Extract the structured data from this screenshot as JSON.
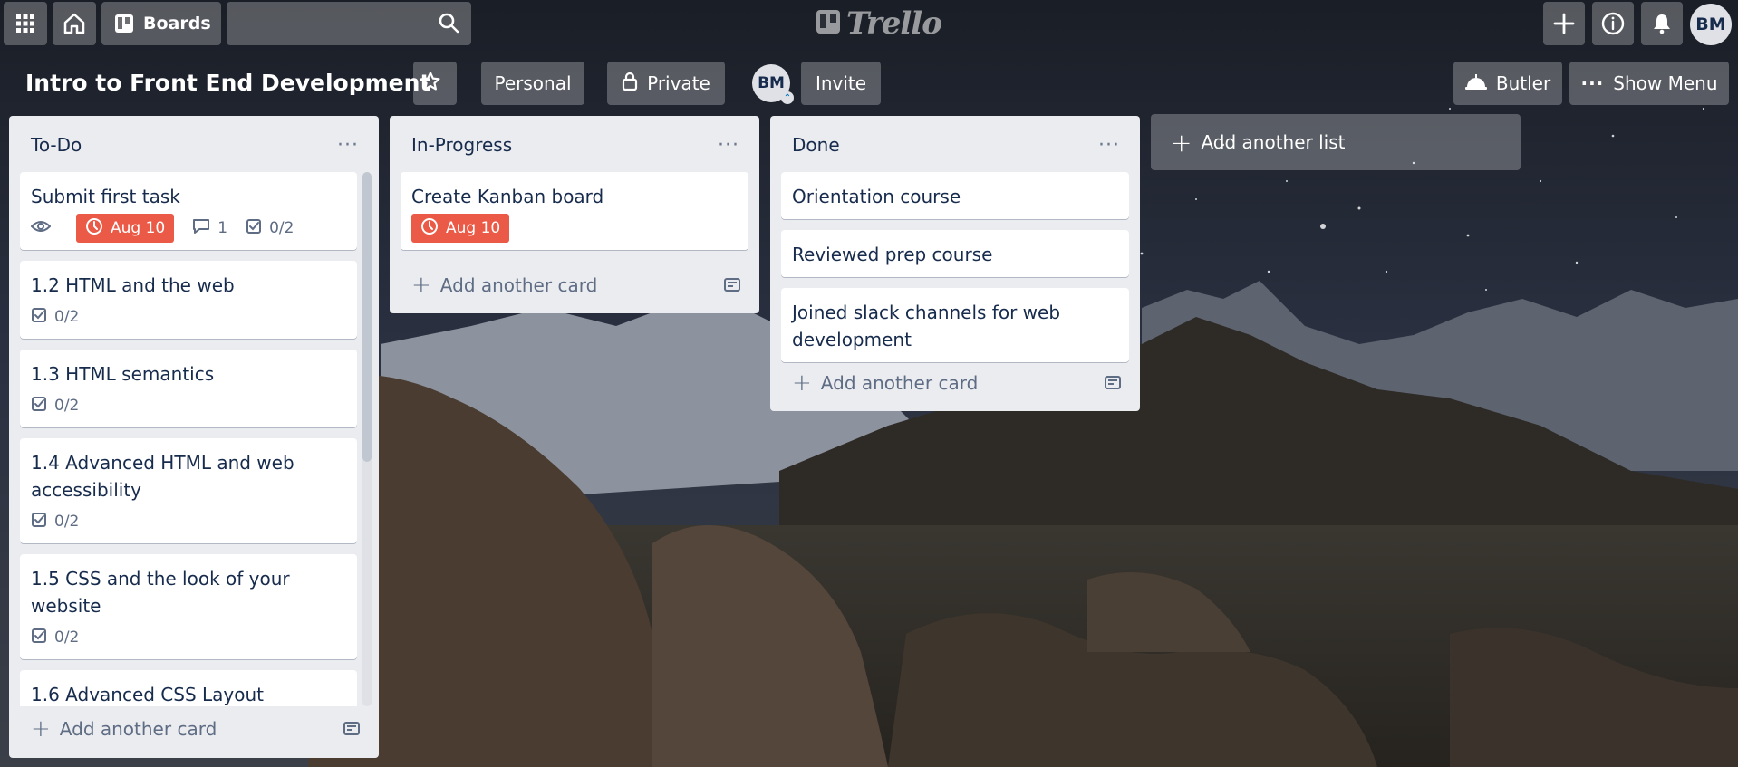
{
  "topbar": {
    "boards_label": "Boards",
    "search_value": "",
    "logo_text": "Trello",
    "avatar_initials": "BM"
  },
  "board": {
    "title": "Intro to Front End Development",
    "visibility_team": "Personal",
    "visibility": "Private",
    "member_initials": "BM",
    "invite_label": "Invite",
    "butler_label": "Butler",
    "show_menu_label": "Show Menu"
  },
  "lists": [
    {
      "title": "To-Do",
      "add_card_label": "Add another card",
      "cards": [
        {
          "title": "Submit first task",
          "due": "Aug 10",
          "comments": "1",
          "checklist": "0/2"
        },
        {
          "title": "1.2 HTML and the web",
          "checklist": "0/2"
        },
        {
          "title": "1.3 HTML semantics",
          "checklist": "0/2"
        },
        {
          "title": "1.4 Advanced HTML and web accessibility",
          "checklist": "0/2"
        },
        {
          "title": "1.5 CSS and the look of your website",
          "checklist": "0/2"
        },
        {
          "title": "1.6 Advanced CSS Layout"
        }
      ]
    },
    {
      "title": "In-Progress",
      "add_card_label": "Add another card",
      "cards": [
        {
          "title": "Create Kanban board",
          "due": "Aug 10"
        }
      ]
    },
    {
      "title": "Done",
      "add_card_label": "Add another card",
      "cards": [
        {
          "title": "Orientation course"
        },
        {
          "title": "Reviewed prep course"
        },
        {
          "title": "Joined slack channels for web development"
        }
      ]
    }
  ],
  "add_list_label": "Add another list",
  "colors": {
    "due_red": "#eb5a46",
    "list_bg": "#ebecf0",
    "text_dark": "#172b4d",
    "text_muted": "#5e6c84"
  },
  "icons": [
    "apps-grid-icon",
    "home-icon",
    "boards-icon",
    "search-icon",
    "trello-logo-icon",
    "plus-icon",
    "info-icon",
    "bell-icon",
    "star-icon",
    "lock-icon",
    "butler-icon",
    "dots-icon",
    "eye-icon",
    "clock-icon",
    "comment-icon",
    "checklist-icon",
    "card-template-icon"
  ]
}
